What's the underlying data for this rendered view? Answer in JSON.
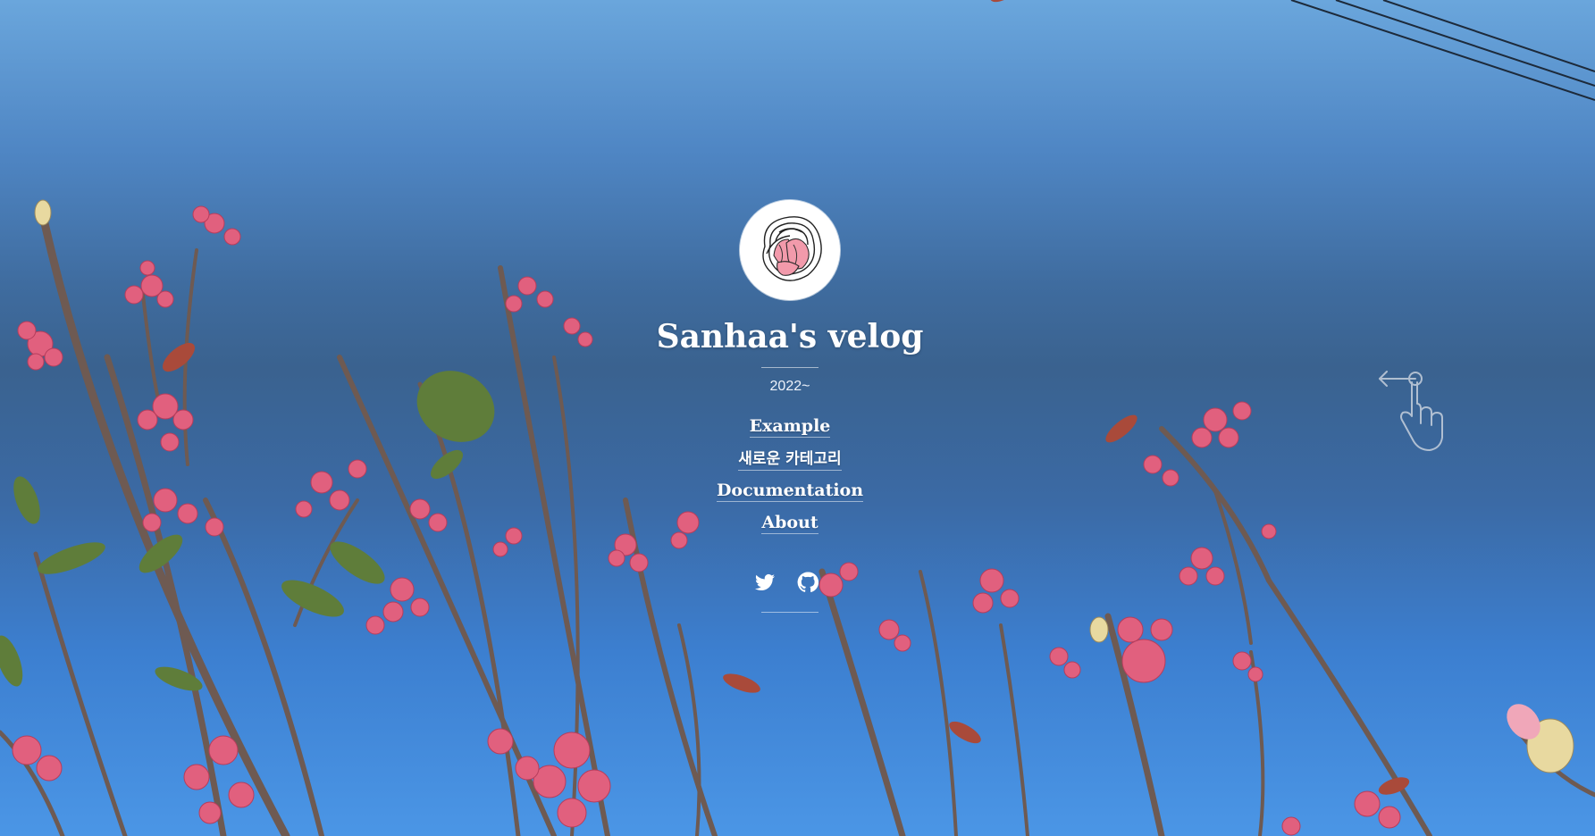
{
  "site": {
    "title": "Sanhaa's velog",
    "description": "2022~"
  },
  "nav": {
    "items": [
      {
        "label": "Example"
      },
      {
        "label": "새로운 카테고리"
      },
      {
        "label": "Documentation"
      },
      {
        "label": "About"
      }
    ]
  },
  "social": {
    "twitter_icon": "twitter-icon",
    "github_icon": "github-icon"
  },
  "hint": {
    "icon": "swipe-left-hand-icon"
  },
  "colors": {
    "text": "#ffffff",
    "sky_top": "#6aa6dc",
    "sky_bottom": "#4b96e6",
    "blossom": "#e0607e"
  }
}
